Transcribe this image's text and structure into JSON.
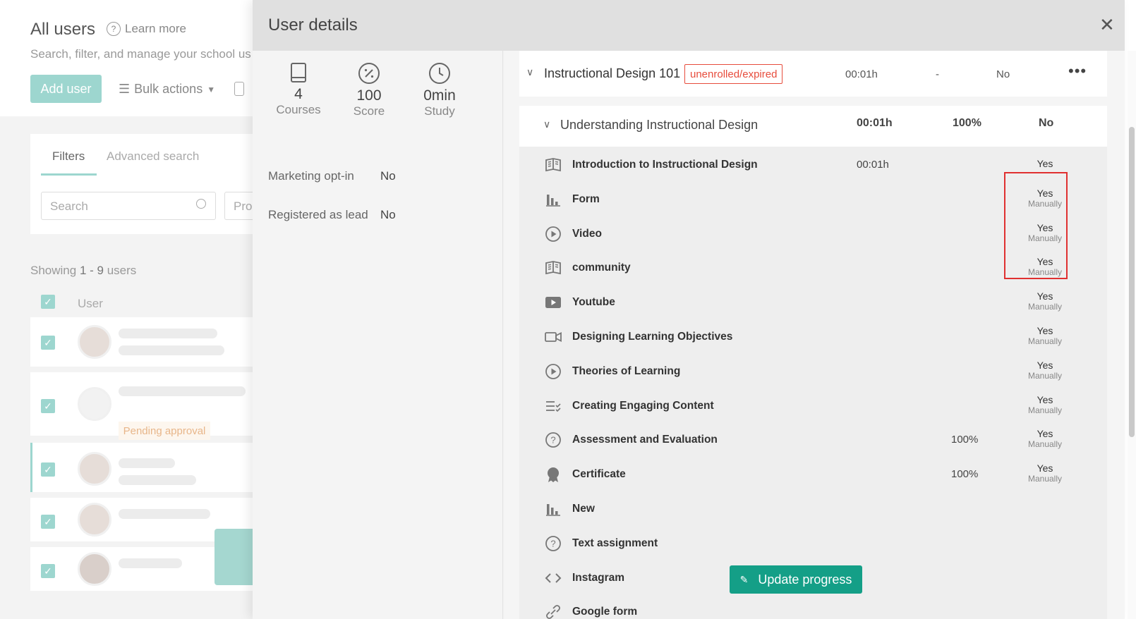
{
  "background": {
    "title": "All users",
    "learn_more": "Learn more",
    "subtitle": "Search, filter, and manage your school us",
    "add_user": "Add user",
    "bulk_actions": "Bulk actions",
    "tabs": [
      "Filters",
      "Advanced search"
    ],
    "search_placeholder": "Search",
    "pro_placeholder": "Pro",
    "showing_prefix": "Showing",
    "showing_range": "1 - 9",
    "showing_suffix": "users",
    "user_column": "User",
    "pending_label": "Pending approval"
  },
  "modal": {
    "title": "User details",
    "close_icon": "close-icon",
    "stats": [
      {
        "icon": "book-icon",
        "value": "4",
        "label": "Courses"
      },
      {
        "icon": "percent-icon",
        "value": "100",
        "label": "Score"
      },
      {
        "icon": "clock-icon",
        "value": "0min",
        "label": "Study"
      }
    ],
    "fields": [
      {
        "key": "Marketing opt-in",
        "value": "No"
      },
      {
        "key": "Registered as lead",
        "value": "No"
      }
    ],
    "course": {
      "title": "Instructional Design 101",
      "status": "unenrolled/expired",
      "time": "00:01h",
      "score": "-",
      "completed": "No"
    },
    "section": {
      "title": "Understanding Instructional Design",
      "time": "00:01h",
      "score": "100%",
      "completed": "No"
    },
    "lessons": [
      {
        "icon": "book-open-icon",
        "name": "Introduction to Instructional Design",
        "time": "00:01h",
        "pct": "",
        "yes": "Yes",
        "sub": ""
      },
      {
        "icon": "bar-chart-icon",
        "name": "Form",
        "time": "",
        "pct": "",
        "yes": "Yes",
        "sub": "Manually"
      },
      {
        "icon": "play-circle-icon",
        "name": "Video",
        "time": "",
        "pct": "",
        "yes": "Yes",
        "sub": "Manually"
      },
      {
        "icon": "book-open-icon",
        "name": "community",
        "time": "",
        "pct": "",
        "yes": "Yes",
        "sub": "Manually"
      },
      {
        "icon": "youtube-icon",
        "name": "Youtube",
        "time": "",
        "pct": "",
        "yes": "Yes",
        "sub": "Manually"
      },
      {
        "icon": "video-camera-icon",
        "name": "Designing Learning Objectives",
        "time": "",
        "pct": "",
        "yes": "Yes",
        "sub": "Manually"
      },
      {
        "icon": "play-circle-icon",
        "name": "Theories of Learning",
        "time": "",
        "pct": "",
        "yes": "Yes",
        "sub": "Manually"
      },
      {
        "icon": "checklist-icon",
        "name": "Creating Engaging Content",
        "time": "",
        "pct": "",
        "yes": "Yes",
        "sub": "Manually"
      },
      {
        "icon": "question-circle-icon",
        "name": "Assessment and Evaluation",
        "time": "",
        "pct": "100%",
        "yes": "Yes",
        "sub": "Manually"
      },
      {
        "icon": "certificate-icon",
        "name": "Certificate",
        "time": "",
        "pct": "100%",
        "yes": "Yes",
        "sub": "Manually"
      },
      {
        "icon": "bar-chart-icon",
        "name": "New",
        "time": "",
        "pct": "",
        "yes": "",
        "sub": ""
      },
      {
        "icon": "question-circle-icon",
        "name": "Text assignment",
        "time": "",
        "pct": "",
        "yes": "",
        "sub": ""
      },
      {
        "icon": "code-icon",
        "name": "Instagram",
        "time": "",
        "pct": "",
        "yes": "",
        "sub": ""
      },
      {
        "icon": "link-icon",
        "name": "Google form",
        "time": "",
        "pct": "",
        "yes": "",
        "sub": ""
      }
    ],
    "update_button": "Update progress"
  },
  "colors": {
    "accent": "#149f87",
    "accent_light": "#9dd6cf",
    "danger": "#e74c3c"
  }
}
